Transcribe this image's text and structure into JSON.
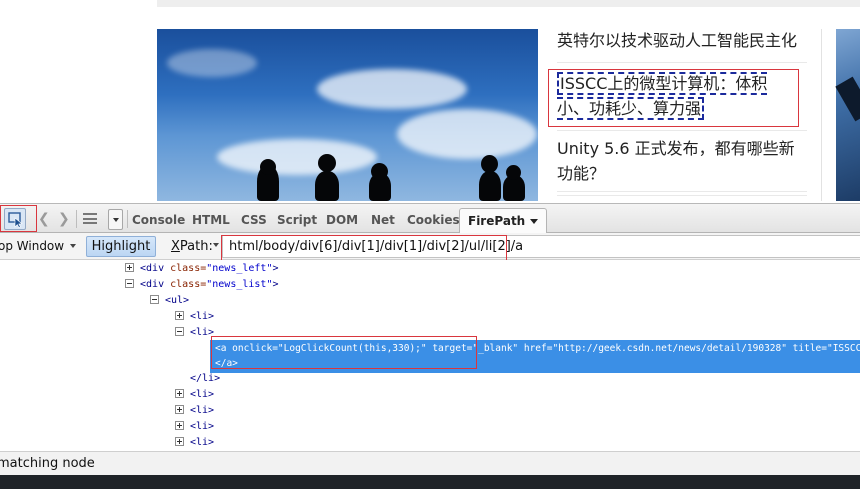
{
  "news": {
    "items": [
      {
        "title": "英特尔以技术驱动人工智能民主化"
      },
      {
        "title": "ISSCC上的微型计算机：体积小、功耗少、算力强"
      },
      {
        "title": "Unity 5.6 正式发布，都有哪些新功能？"
      }
    ]
  },
  "firebug": {
    "toolbar": {
      "tabs": [
        "Console",
        "HTML",
        "CSS",
        "Script",
        "DOM",
        "Net",
        "Cookies"
      ],
      "active_tab": "FirePath"
    },
    "xpath_bar": {
      "window_label": "op Window",
      "highlight_label": "Highlight",
      "xpath_label_prefix": "X",
      "xpath_label_rest": "Path:",
      "xpath_value": "html/body/div[6]/div[1]/div[1]/div[2]/ul/li[2]/a"
    },
    "tree": {
      "rows": [
        {
          "open": "<",
          "tag": "div",
          "attr": " class=",
          "val": "\"news_left\"",
          "close": ">"
        },
        {
          "open": "<",
          "tag": "div",
          "attr": " class=",
          "val": "\"news_list\"",
          "close": ">"
        },
        {
          "text": "<ul>"
        },
        {
          "text": "<li>"
        },
        {
          "text": "<li>"
        },
        {
          "text": "</li>"
        },
        {
          "text": "<li>"
        },
        {
          "text": "<li>"
        },
        {
          "text": "<li>"
        },
        {
          "text": "<li>"
        }
      ],
      "selected_line1": "<a onclick=\"LogClickCount(this,330);\" target=\"_blank\" href=\"http://geek.csdn.net/news/detail/190328\" title=\"ISSCC上的",
      "selected_line2": "</a>"
    },
    "status": "matching node"
  },
  "colors": {
    "accent_selection": "#3b8fe6",
    "annotation_red": "#d9363e",
    "dashed_highlight": "#1b2a9c"
  }
}
